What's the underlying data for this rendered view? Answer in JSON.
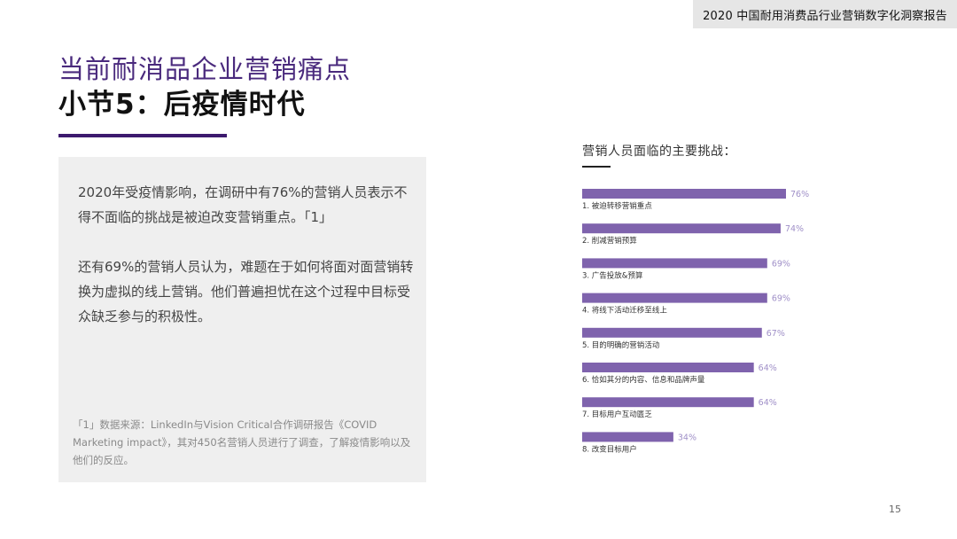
{
  "header": {
    "report_title": "2020 中国耐用消费品行业营销数字化洞察报告"
  },
  "slide": {
    "section_title": "当前耐消品企业营销痛点",
    "subtitle": "小节5：后疫情时代"
  },
  "text_panel": {
    "paragraph_1": "2020年受疫情影响，在调研中有76%的营销人员表示不得不面临的挑战是被迫改变营销重点。「1」",
    "paragraph_2": "还有69%的营销人员认为，难题在于如何将面对面营销转换为虚拟的线上营销。他们普遍担忧在这个过程中目标受众缺乏参与的积极性。",
    "footnote": "「1」数据来源：LinkedIn与Vision Critical合作调研报告《COVID Marketing impact》，其对450名营销人员进行了调查，了解疫情影响以及他们的反应。"
  },
  "colors": {
    "bar": "#7f63ad",
    "accent": "#3d1a6e",
    "value_text": "#a090c8"
  },
  "chart_data": {
    "type": "bar",
    "orientation": "horizontal",
    "title": "营销人员面临的主要挑战：",
    "categories": [
      "1. 被迫转移营销重点",
      "2. 削减营销预算",
      "3. 广告投放&预算",
      "4. 将线下活动迁移至线上",
      "5. 目的明确的营销活动",
      "6. 恰如其分的内容、信息和品牌声量",
      "7. 目标用户互动匮乏",
      "8. 改变目标用户"
    ],
    "values": [
      76,
      74,
      69,
      69,
      67,
      64,
      64,
      34
    ],
    "value_labels": [
      "76%",
      "74%",
      "69%",
      "69%",
      "67%",
      "64%",
      "64%",
      "34%"
    ],
    "unit": "%",
    "xlim": [
      0,
      100
    ],
    "grid": false,
    "legend": "none"
  },
  "footer": {
    "page_number": "15"
  }
}
